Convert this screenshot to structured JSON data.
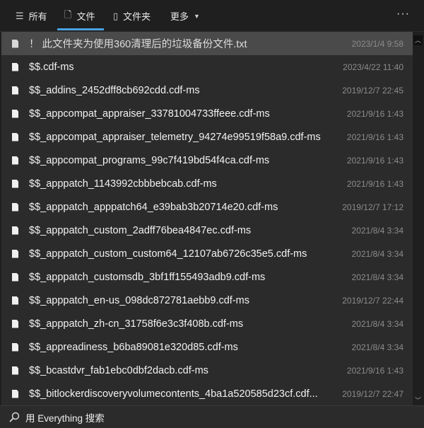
{
  "tabs": [
    {
      "label": "所有",
      "icon": "list-icon"
    },
    {
      "label": "文件",
      "icon": "file-icon"
    },
    {
      "label": "文件夹",
      "icon": "folder-icon"
    },
    {
      "label": "更多",
      "icon": "caret-down-icon"
    }
  ],
  "more_label": "···",
  "files": [
    {
      "name": "！ 此文件夹为使用360清理后的垃圾备份文件.txt",
      "date": "2023/1/4 9:58"
    },
    {
      "name": "$$.cdf-ms",
      "date": "2023/4/22 11:40"
    },
    {
      "name": "$$_addins_2452dff8cb692cdd.cdf-ms",
      "date": "2019/12/7 22:45"
    },
    {
      "name": "$$_appcompat_appraiser_33781004733ffeee.cdf-ms",
      "date": "2021/9/16 1:43"
    },
    {
      "name": "$$_appcompat_appraiser_telemetry_94274e99519f58a9.cdf-ms",
      "date": "2021/9/16 1:43"
    },
    {
      "name": "$$_appcompat_programs_99c7f419bd54f4ca.cdf-ms",
      "date": "2021/9/16 1:43"
    },
    {
      "name": "$$_apppatch_1143992cbbbebcab.cdf-ms",
      "date": "2021/9/16 1:43"
    },
    {
      "name": "$$_apppatch_apppatch64_e39bab3b20714e20.cdf-ms",
      "date": "2019/12/7 17:12"
    },
    {
      "name": "$$_apppatch_custom_2adff76bea4847ec.cdf-ms",
      "date": "2021/8/4 3:34"
    },
    {
      "name": "$$_apppatch_custom_custom64_12107ab6726c35e5.cdf-ms",
      "date": "2021/8/4 3:34"
    },
    {
      "name": "$$_apppatch_customsdb_3bf1ff155493adb9.cdf-ms",
      "date": "2021/8/4 3:34"
    },
    {
      "name": "$$_apppatch_en-us_098dc872781aebb9.cdf-ms",
      "date": "2019/12/7 22:44"
    },
    {
      "name": "$$_apppatch_zh-cn_31758f6e3c3f408b.cdf-ms",
      "date": "2021/8/4 3:34"
    },
    {
      "name": "$$_appreadiness_b6ba89081e320d85.cdf-ms",
      "date": "2021/8/4 3:34"
    },
    {
      "name": "$$_bcastdvr_fab1ebc0dbf2dacb.cdf-ms",
      "date": "2021/9/16 1:43"
    },
    {
      "name": "$$_bitlockerdiscoveryvolumecontents_4ba1a520585d23cf.cdf...",
      "date": "2019/12/7 22:47"
    }
  ],
  "footer": {
    "label": "用 Everything 搜索",
    "icon": "search-icon"
  },
  "colors": {
    "accent": "#4aa3e0",
    "selected_row": "#4a4a4a"
  }
}
